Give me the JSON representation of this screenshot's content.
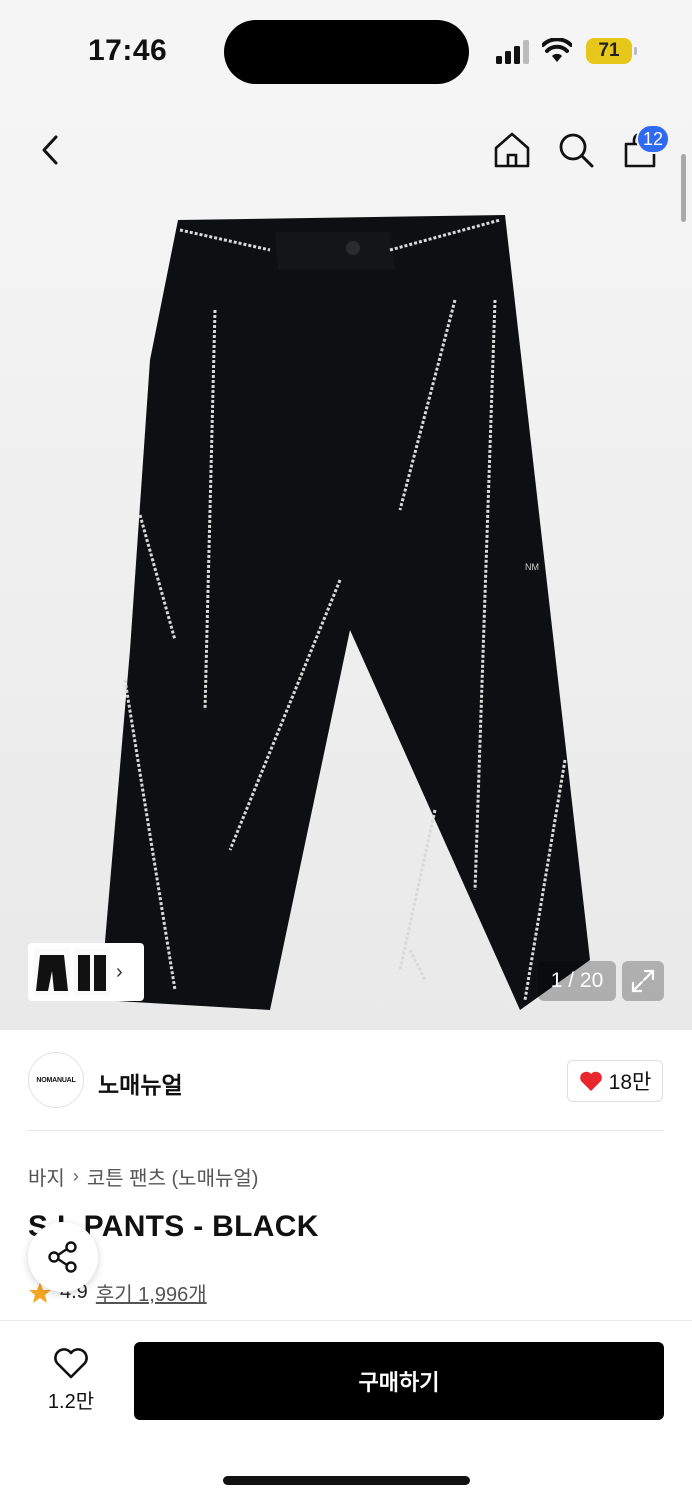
{
  "status_bar": {
    "time": "17:46",
    "battery": "71"
  },
  "header": {
    "cart_count": "12"
  },
  "gallery": {
    "counter": "1 / 20",
    "arrow": "›"
  },
  "brand": {
    "logo_text": "NOMANUAL",
    "name": "노매뉴얼",
    "likes": "18만"
  },
  "breadcrumb": {
    "category": "바지",
    "separator": "›",
    "subcategory": "코튼 팬츠 (노매뉴얼)"
  },
  "product": {
    "title": "S.L PANTS - BLACK",
    "rating": "4.9",
    "review_label": "후기 1,996개",
    "logo_mark": "NM"
  },
  "bottom_bar": {
    "wish_count": "1.2만",
    "buy_label": "구매하기"
  },
  "colors": {
    "badge": "#2f6bf2",
    "heart": "#e8262b",
    "star": "#f5a623",
    "battery": "#e7c81a"
  }
}
